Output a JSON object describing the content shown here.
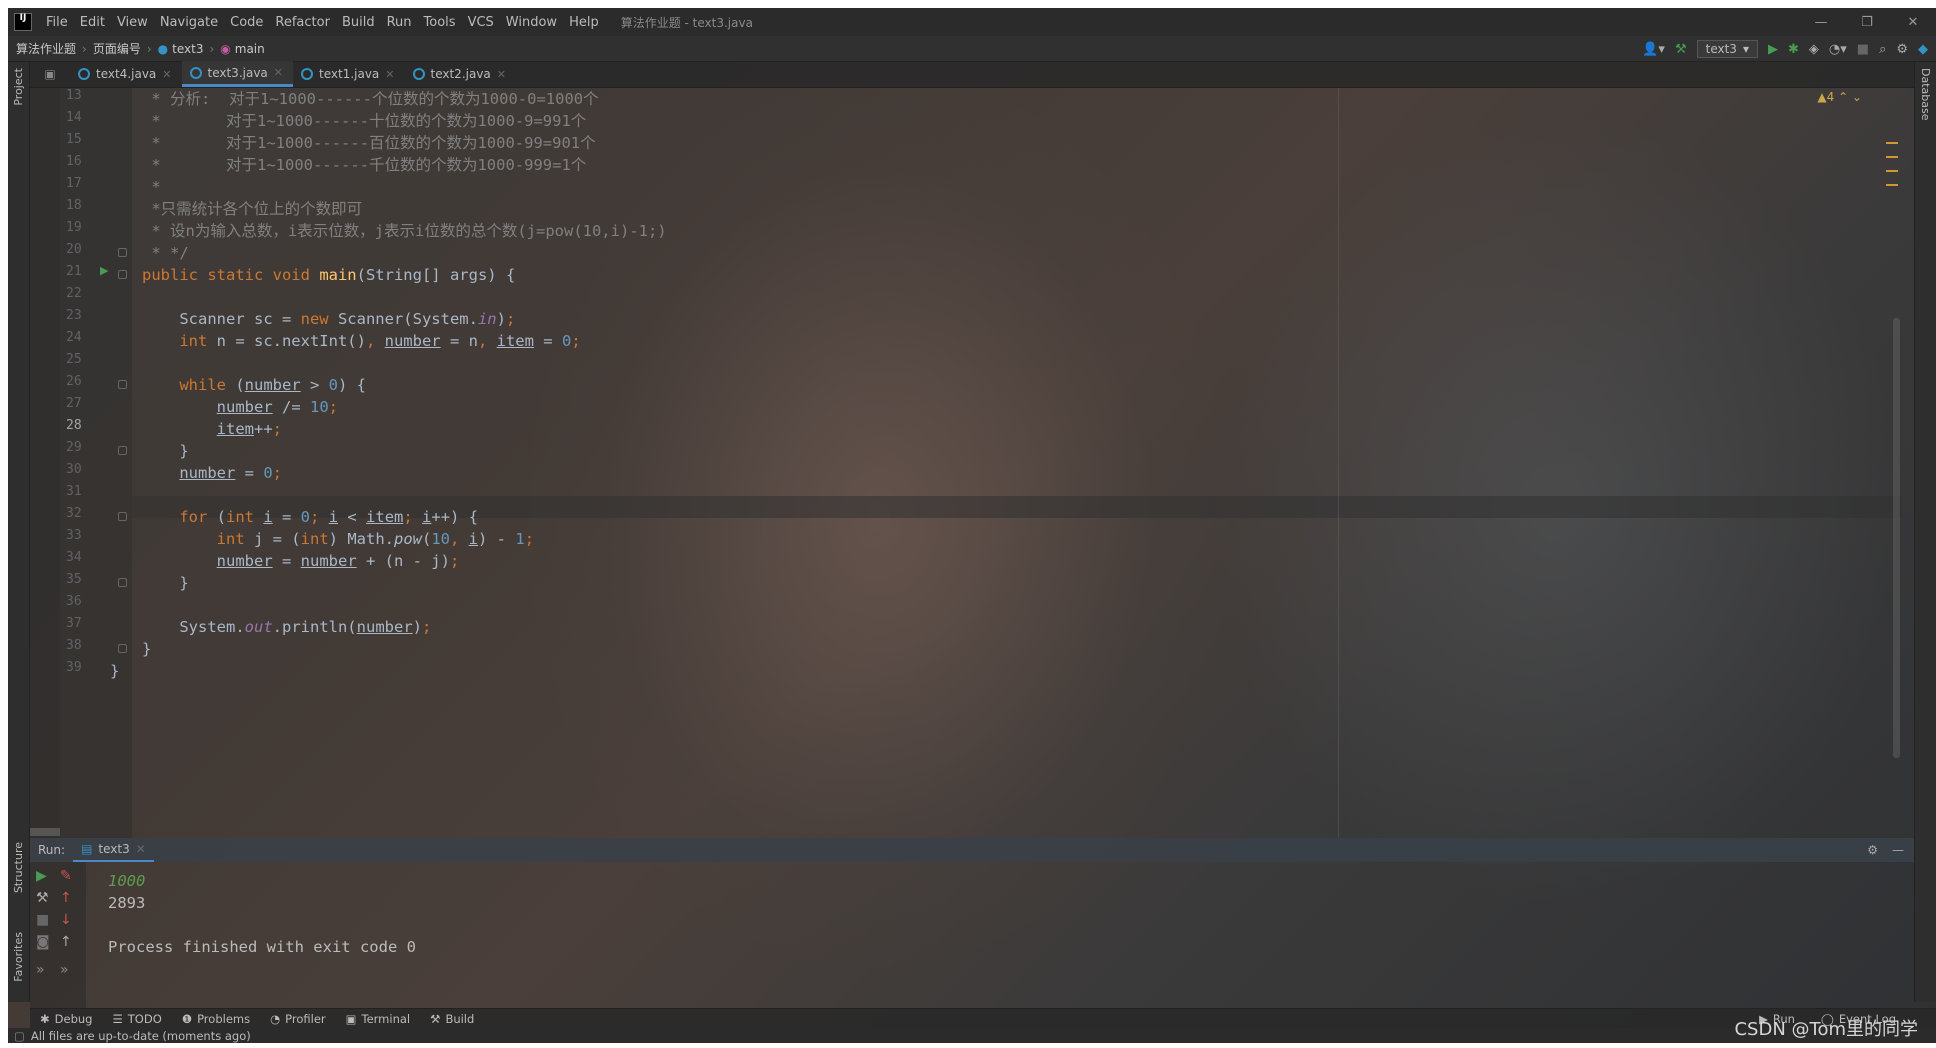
{
  "menu": [
    "File",
    "Edit",
    "View",
    "Navigate",
    "Code",
    "Refactor",
    "Build",
    "Run",
    "Tools",
    "VCS",
    "Window",
    "Help"
  ],
  "window_title": "算法作业题 - text3.java",
  "breadcrumb": {
    "project": "算法作业题",
    "folder": "页面编号",
    "cls": "text3",
    "method": "main"
  },
  "run_config": "text3",
  "tabs": [
    "text4.java",
    "text3.java",
    "text1.java",
    "text2.java"
  ],
  "left_tabs": {
    "project": "Project",
    "structure": "Structure",
    "favorites": "Favorites"
  },
  "right_tab": "Database",
  "warnings": "▲4",
  "line_numbers": [
    "13",
    "14",
    "15",
    "16",
    "17",
    "18",
    "19",
    "20",
    "21",
    "22",
    "23",
    "24",
    "25",
    "26",
    "27",
    "28",
    "29",
    "30",
    "31",
    "32",
    "33",
    "34",
    "35",
    "36",
    "37",
    "38",
    "39"
  ],
  "code": {
    "l13": " * 分析:  对于1~1000------个位数的个数为1000-0=1000个",
    "l14": " *       对于1~1000------十位数的个数为1000-9=991个",
    "l15": " *       对于1~1000------百位数的个数为1000-99=901个",
    "l16": " *       对于1~1000------千位数的个数为1000-999=1个",
    "l17": " *",
    "l18": " *只需统计各个位上的个数即可",
    "l19": " * 设n为输入总数，i表示位数，j表示i位数的总个数(j=pow(10,i)-1;)",
    "l20": " * */"
  },
  "run_panel": {
    "label": "Run:",
    "tab": "text3"
  },
  "console": {
    "input": "1000",
    "output": "2893",
    "finished": "Process finished with exit code 0"
  },
  "bottom_tools": [
    "Debug",
    "TODO",
    "Problems",
    "Profiler",
    "Terminal",
    "Build"
  ],
  "bottom_right": {
    "run": "Run",
    "event_log": "Event Log"
  },
  "status": "All files are up-to-date (moments ago)",
  "watermark": "CSDN @Tom里的同学"
}
